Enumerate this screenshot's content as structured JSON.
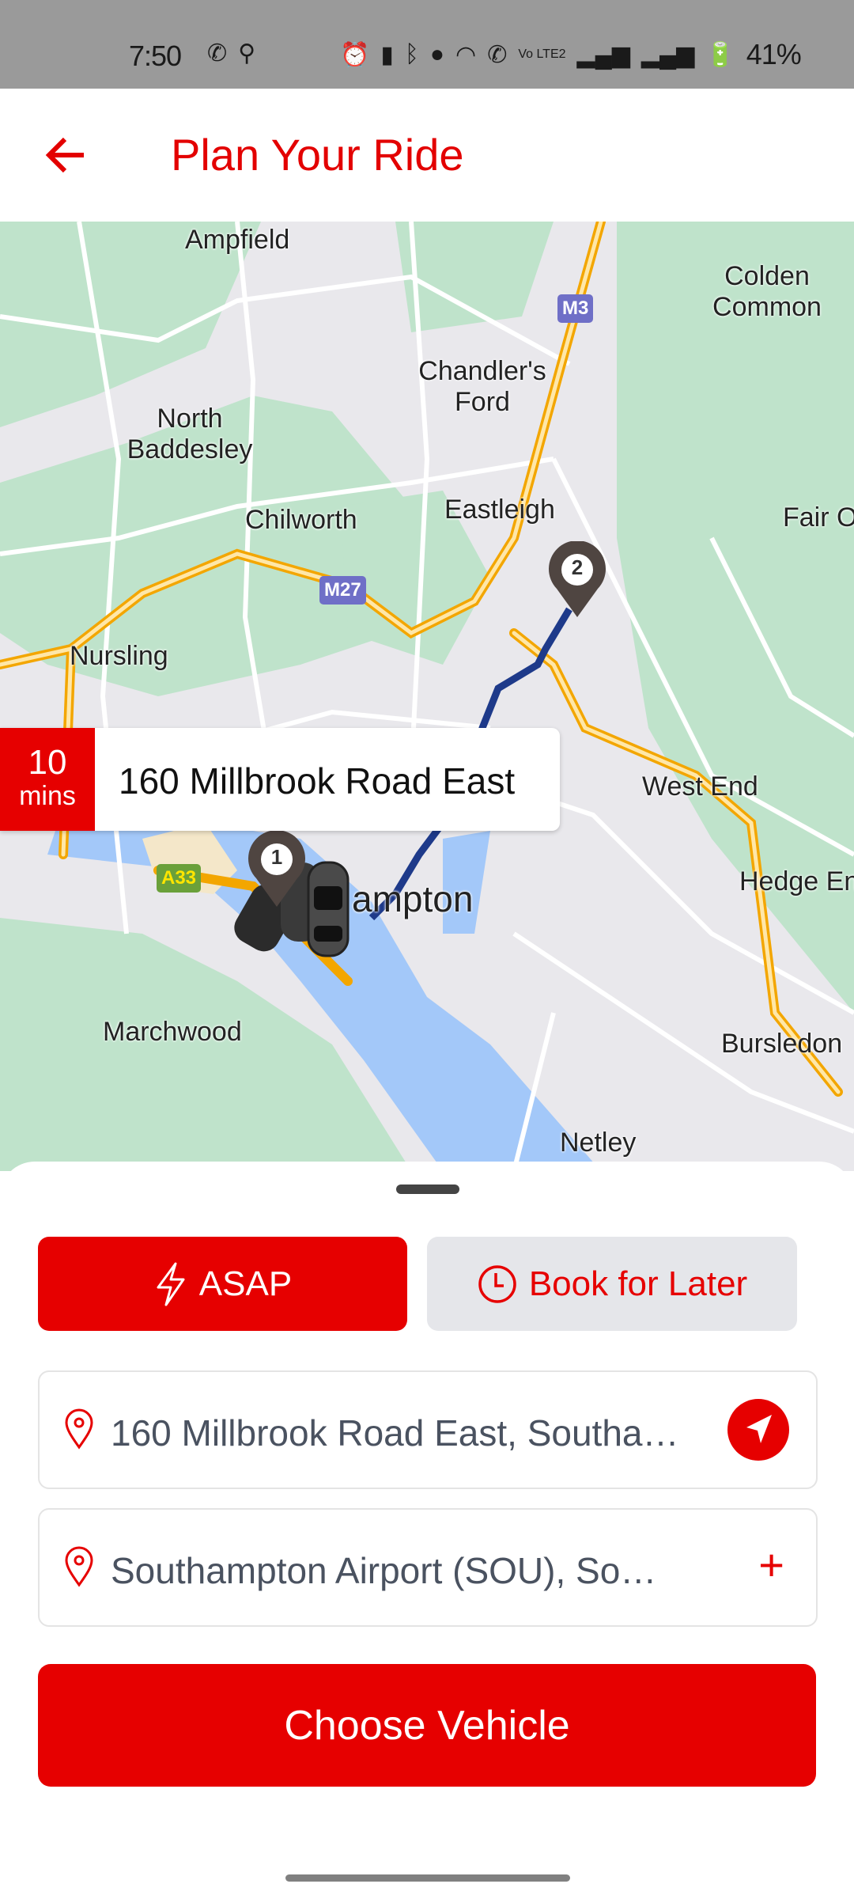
{
  "status_bar": {
    "time": "7:50",
    "battery": "41%",
    "left_icons": [
      "whatsapp-icon",
      "location-icon"
    ],
    "right_icons": [
      "alarm-icon",
      "vibrate-icon",
      "bluetooth-icon",
      "location-icon",
      "wifi-icon",
      "wifi-calling-icon",
      "volte-icon",
      "signal-icon",
      "signal-icon",
      "battery-charging-icon"
    ],
    "volte_label": "Vo LTE2"
  },
  "header": {
    "title": "Plan Your Ride",
    "back_icon": "arrow-left-icon"
  },
  "map": {
    "places": [
      "Ampfield",
      "Colden Common",
      "Chandler's Ford",
      "North Baddesley",
      "Chilworth",
      "Eastleigh",
      "Fair O",
      "Nursling",
      "West End",
      "Hedge En",
      "ampton",
      "Marchwood",
      "Bursledon",
      "Netley"
    ],
    "road_shields": [
      "M3",
      "M27",
      "A33"
    ],
    "markers": [
      {
        "label": "1"
      },
      {
        "label": "2"
      }
    ],
    "eta": {
      "value": "10",
      "unit": "mins",
      "address": "160 Millbrook Road East"
    }
  },
  "booking": {
    "asap_label": "ASAP",
    "later_label": "Book for Later",
    "pickup": "160 Millbrook Road East, Southa…",
    "dropoff": "Southampton Airport (SOU), So…",
    "choose_label": "Choose Vehicle"
  },
  "colors": {
    "brand": "#e60000",
    "route": "#1e3a8a"
  }
}
